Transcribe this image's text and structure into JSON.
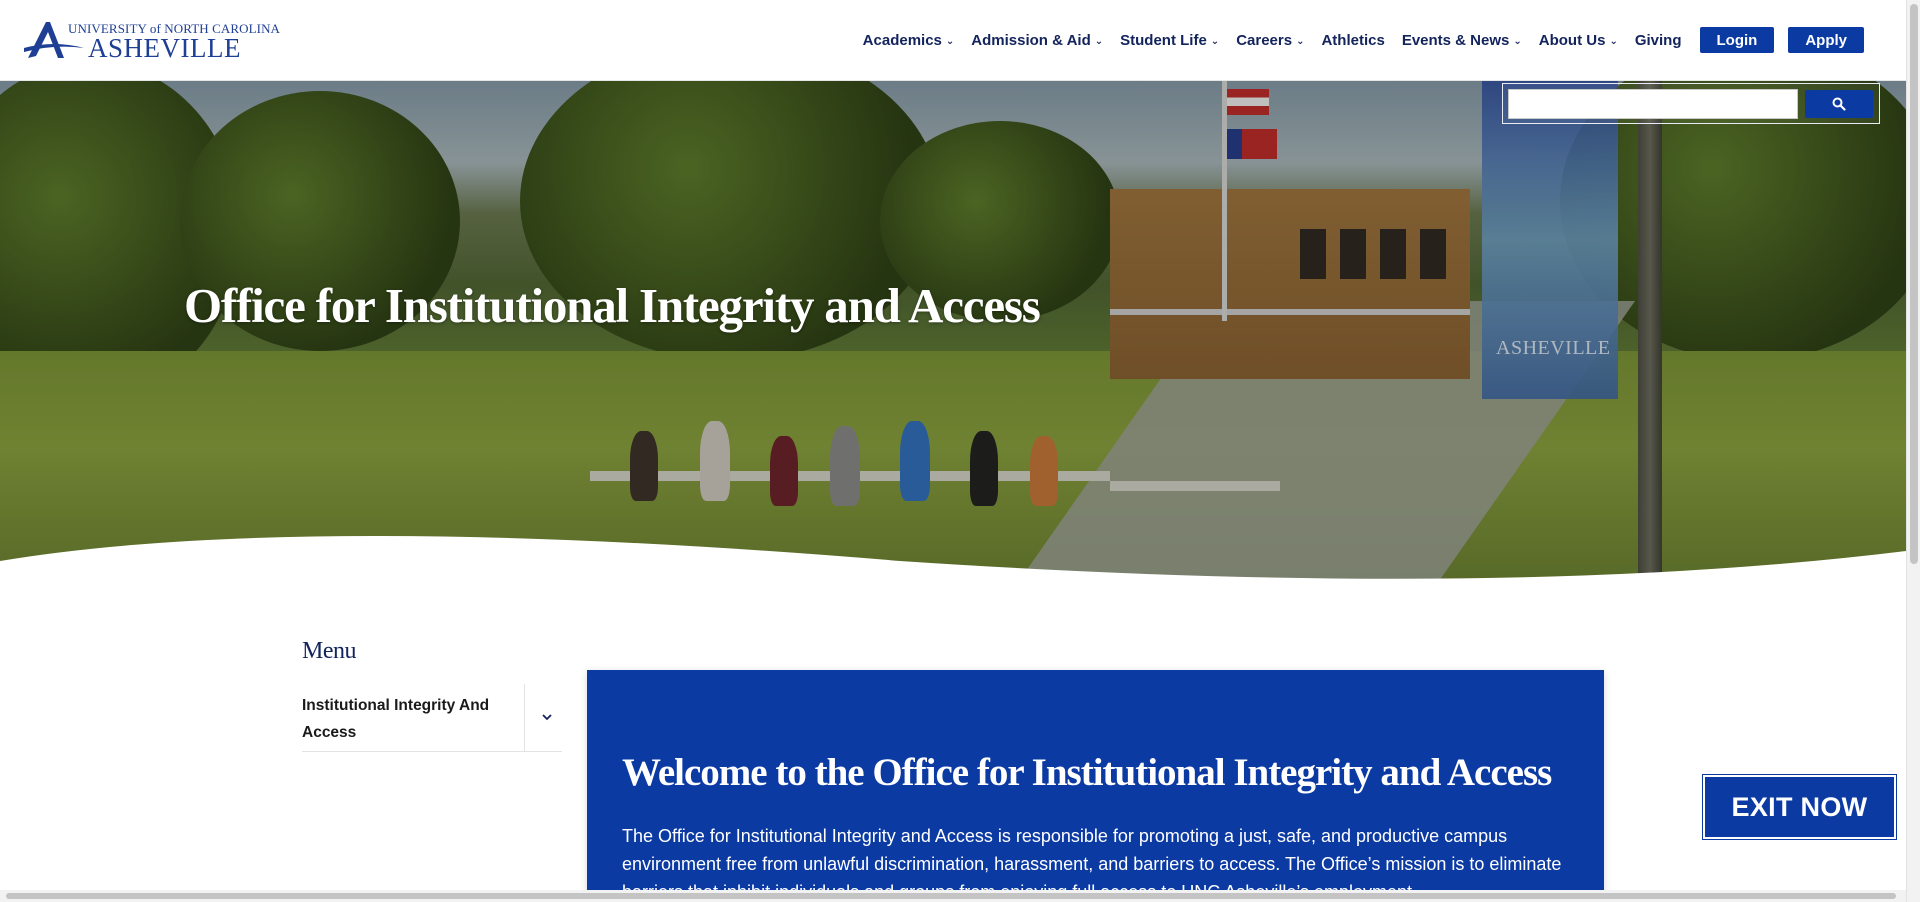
{
  "logo": {
    "small_text": "UNIVERSITY of NORTH CAROLINA",
    "big_text": "ASHEVILLE"
  },
  "nav": {
    "items": [
      {
        "label": "Academics",
        "has_dropdown": true
      },
      {
        "label": "Admission & Aid",
        "has_dropdown": true
      },
      {
        "label": "Student Life",
        "has_dropdown": true
      },
      {
        "label": "Careers",
        "has_dropdown": true
      },
      {
        "label": "Athletics",
        "has_dropdown": false
      },
      {
        "label": "Events & News",
        "has_dropdown": true
      },
      {
        "label": "About Us",
        "has_dropdown": true
      },
      {
        "label": "Giving",
        "has_dropdown": false
      }
    ],
    "login_label": "Login",
    "apply_label": "Apply",
    "chevron_glyph": "⌄"
  },
  "search": {
    "value": "",
    "icon": "search-icon"
  },
  "hero": {
    "title": "Office for Institutional Integrity and Access",
    "banner_text": "ASHEVILLE"
  },
  "sidebar": {
    "title": "Menu",
    "items": [
      {
        "label": "Institutional Integrity And Access",
        "toggle_icon": "chevron-down-icon"
      }
    ]
  },
  "welcome": {
    "title": "Welcome to the Office for Institutional Integrity and Access",
    "body": "The Office for Institutional Integrity and Access is responsible for promoting a just, safe, and productive campus environment free from unlawful discrimination, harassment, and barriers to access. The Office’s mission is to eliminate barriers that inhibit individuals and groups from enjoying full access to UNC Asheville’s employment"
  },
  "exit_button": {
    "label": "EXIT NOW"
  },
  "colors": {
    "brand_blue": "#0b3aa3",
    "nav_text": "#13235b",
    "logo_blue": "#1f3f95"
  }
}
